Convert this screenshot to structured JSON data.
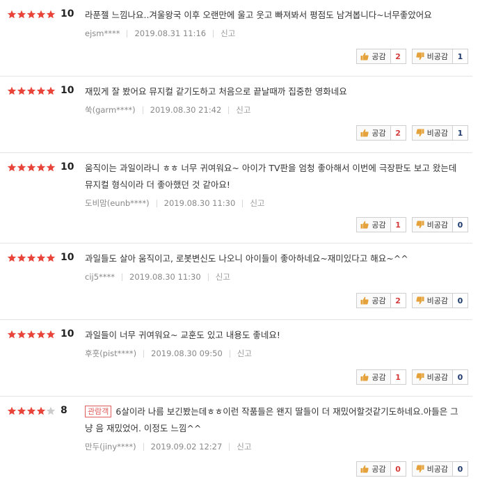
{
  "labels": {
    "like": "공감",
    "dislike": "비공감",
    "report": "신고"
  },
  "colors": {
    "star_on": "#e8443a",
    "star_off": "#cccccc",
    "like_count": "#d53b3b",
    "dislike_count": "#1e3a6e",
    "badge": "#e05b5b"
  },
  "reviews": [
    {
      "stars": 5,
      "score": "10",
      "text": "라푼젤 느낌나요..겨울왕국 이후 오랜만에 울고 웃고 빠져봐서 평점도 남겨봅니다~너무좋았어요",
      "author": "ejsm****",
      "date": "2019.08.31 11:16",
      "likes": "2",
      "dislikes": "1"
    },
    {
      "stars": 5,
      "score": "10",
      "text": "재밌게 잘 봤어요 뮤지컬 같기도하고 처음으로 끝날때까 집중한 영화네요",
      "author": "쑥(garm****)",
      "date": "2019.08.30 21:42",
      "likes": "2",
      "dislikes": "1"
    },
    {
      "stars": 5,
      "score": "10",
      "text": "움직이는 과일이라니 ㅎㅎ 너무 귀여워요~ 아이가 TV판을 엄청 좋아해서 이번에 극장판도 보고 왔는데 뮤지컬 형식이라 더 좋아했던 것 같아요!",
      "author": "도비맘(eunb****)",
      "date": "2019.08.30 11:30",
      "likes": "1",
      "dislikes": "0"
    },
    {
      "stars": 5,
      "score": "10",
      "text": "과일들도 살아 움직이고, 로봇변신도 나오니 아이들이 좋아하네요~재미있다고 해요~^^",
      "author": "cij5****",
      "date": "2019.08.30 11:30",
      "likes": "2",
      "dislikes": "0"
    },
    {
      "stars": 5,
      "score": "10",
      "text": "과일들이 너무 귀여워요~ 교훈도 있고 내용도 좋네요!",
      "author": "후훗(pist****)",
      "date": "2019.08.30 09:50",
      "likes": "1",
      "dislikes": "0"
    },
    {
      "stars": 4,
      "score": "8",
      "badge": "관람객",
      "text": "6살이라 나름 보긴봤는데ㅎㅎ이런 작품들은 왠지 딸들이 더 재밌어할것같기도하네요.아들은 그냥 음 재밌었어. 이정도 느낌^^",
      "author": "만두(jiny****)",
      "date": "2019.09.02 12:27",
      "likes": "0",
      "dislikes": "0"
    }
  ]
}
